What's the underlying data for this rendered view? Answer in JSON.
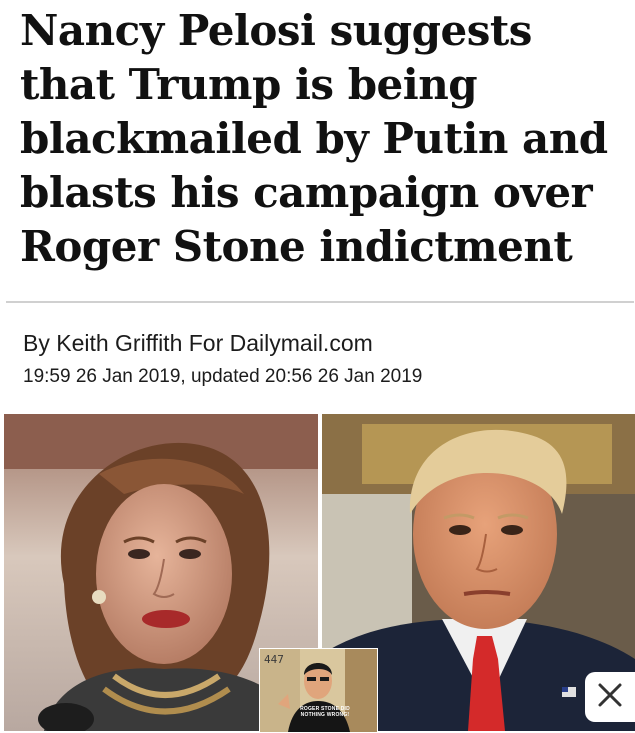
{
  "article": {
    "headline": "Nancy Pelosi suggests that Trump is being blackmailed by Putin and blasts his campaign over Roger Stone indictment",
    "byline": "By Keith Griffith For Dailymail.com",
    "dateline": "19:59 26 Jan 2019, updated 20:56 26 Jan 2019"
  },
  "images": {
    "inset_number": "447",
    "inset_shirt_text": "ROGER STONE DID NOTHING WRONG!"
  },
  "icons": {
    "close": "close-icon"
  },
  "colors": {
    "headline": "#111111",
    "text": "#1c1c1c",
    "divider": "#d0d0d0",
    "tie": "#d42a2a"
  }
}
